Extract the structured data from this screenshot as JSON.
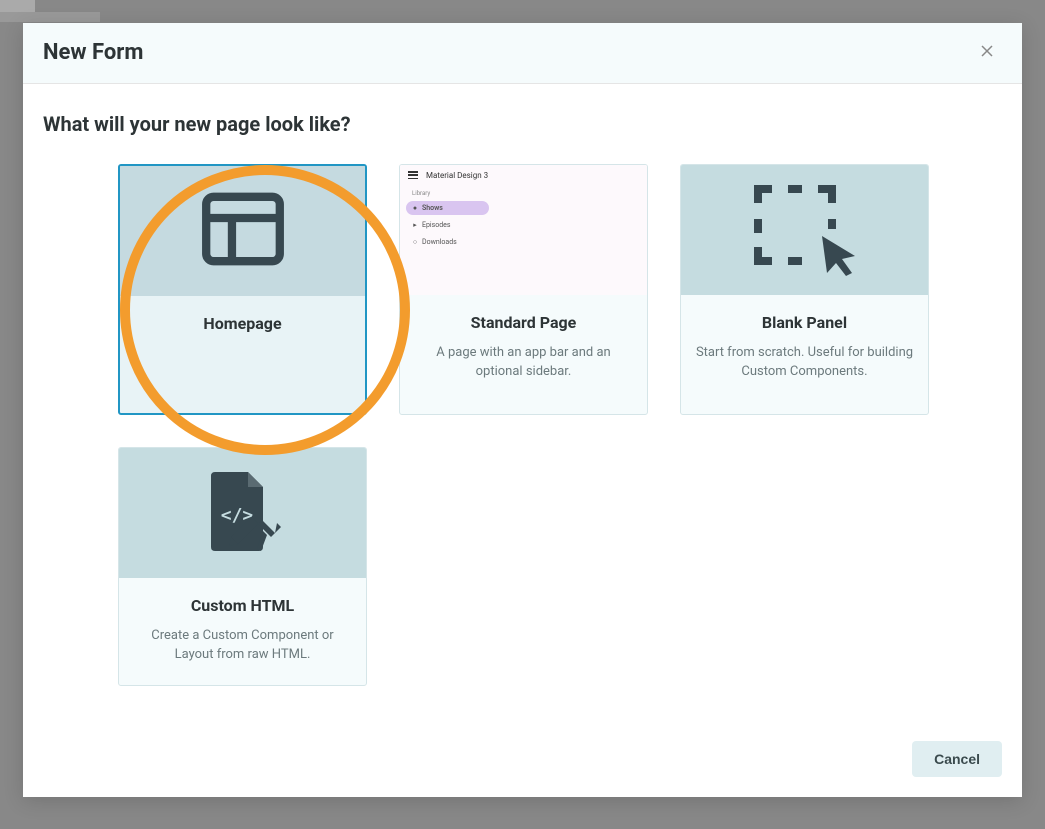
{
  "modal": {
    "title": "New Form",
    "body_title": "What will your new page look like?",
    "cancel_label": "Cancel"
  },
  "cards": {
    "homepage": {
      "title": "Homepage",
      "desc": ""
    },
    "standard": {
      "title": "Standard Page",
      "desc": "A page with an app bar and an optional sidebar."
    },
    "blank": {
      "title": "Blank Panel",
      "desc": "Start from scratch. Useful for building Custom Components."
    },
    "custom_html": {
      "title": "Custom HTML",
      "desc": "Create a Custom Component or Layout from raw HTML."
    }
  },
  "standard_preview": {
    "header_title": "Material Design 3",
    "sidebar_label": "Library",
    "items": [
      "Shows",
      "Episodes",
      "Downloads"
    ]
  }
}
